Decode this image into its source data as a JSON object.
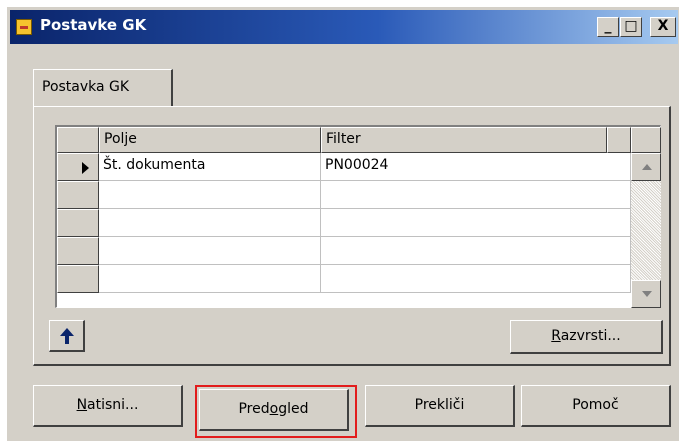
{
  "window": {
    "title": "Postavke GK",
    "controls": [
      "_",
      "□",
      "X"
    ]
  },
  "tab": {
    "label": "Postavka GK"
  },
  "grid": {
    "columns": [
      "Polje",
      "Filter"
    ],
    "rows": [
      {
        "field": "Št. dokumenta",
        "filter": "PN00024",
        "current": true
      },
      {
        "field": "",
        "filter": "",
        "current": false
      },
      {
        "field": "",
        "filter": "",
        "current": false
      },
      {
        "field": "",
        "filter": "",
        "current": false
      },
      {
        "field": "",
        "filter": "",
        "current": false
      }
    ]
  },
  "buttons": {
    "sort": {
      "pre": "",
      "key": "R",
      "post": "azvrsti..."
    },
    "print": {
      "pre": "",
      "key": "N",
      "post": "atisni..."
    },
    "preview": {
      "pre": "Pred",
      "key": "o",
      "post": "gled"
    },
    "cancel": {
      "label": "Prekliči"
    },
    "help": {
      "label": "Pomoč"
    }
  },
  "icons": {
    "title_icon": "form-icon",
    "move_up": "up-arrow-icon",
    "scroll_up": "scroll-up-icon",
    "scroll_down": "scroll-down-icon",
    "current_row": "row-pointer-icon"
  },
  "colors": {
    "titlebar_start": "#0a246a",
    "titlebar_end": "#a6caf0",
    "face": "#d4d0c8",
    "highlight_box": "#e21c1c"
  }
}
